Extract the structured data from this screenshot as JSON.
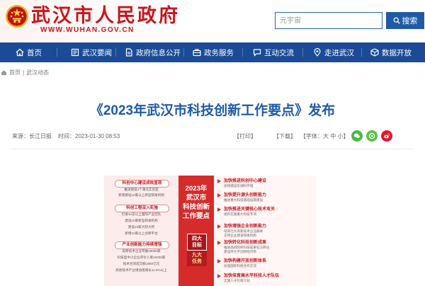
{
  "header": {
    "title": "武汉市人民政府",
    "site_url": "WWW.WUHAN.GOV.CN",
    "search_placeholder": "元宇宙",
    "search_button": "搜索"
  },
  "nav": [
    {
      "label": "首页",
      "icon": "home-icon"
    },
    {
      "label": "武汉要闻",
      "icon": "news-icon"
    },
    {
      "label": "政府信息公开",
      "icon": "document-icon"
    },
    {
      "label": "政务服务",
      "icon": "briefcase-icon"
    },
    {
      "label": "互动交流",
      "icon": "chat-icon"
    },
    {
      "label": "走进武汉",
      "icon": "map-pin-icon"
    },
    {
      "label": "数据开放",
      "icon": "data-icon"
    }
  ],
  "breadcrumb": {
    "home": "首页",
    "separator": "|",
    "current": "武汉动态"
  },
  "article": {
    "title": "《2023年武汉市科技创新工作要点》发布",
    "source": "来源：长江日报",
    "time": "时间：2023-01-30 08:53",
    "print": "【打印】",
    "download": "【下载】",
    "font_prefix": "【字体：",
    "font_large": "大",
    "font_medium": "中",
    "font_small": "小",
    "font_suffix": "】"
  },
  "share": [
    {
      "icon": "wechat-icon",
      "color": "#4cb848"
    },
    {
      "icon": "moments-icon",
      "color": "#5cc24a"
    },
    {
      "icon": "weibo-icon",
      "color": "#e6162d"
    }
  ],
  "infographic": {
    "center_title": [
      "2023年",
      "武汉市",
      "科技创新",
      "工作要点"
    ],
    "goals": [
      "四大",
      "目标"
    ],
    "tasks": [
      "九大",
      "任务"
    ],
    "left": [
      {
        "heading": "科创中心建设成效显现",
        "lines": [
          "推进建设4个湖北实验室",
          "新增建设10家以上新型研发机构"
        ]
      },
      {
        "heading": "科创工程深入实施",
        "lines": [
          "引进10支以上国际产业团队",
          "建设10家新型研发机构",
          "建设10家大院大所",
          "新增10家以上创新平台"
        ]
      },
      {
        "heading": "产业创新能力持续增强",
        "lines": [
          "高新技术企业突破15000家",
          "科技型中小企业评价入库16000家",
          "技术合同成交额1850亿元",
          "高新技术产业增加值增长11.5%以上"
        ]
      }
    ],
    "right": [
      {
        "heading": "加快推进科创中心建设",
        "lines": [
          "加快建设东湖科学城"
        ]
      },
      {
        "heading": "加快提升源头创新能力",
        "lines": [
          "推进重大科技基础设施建设"
        ]
      },
      {
        "heading": "加快推进关键核心技术攻关",
        "lines": [
          "组织实施重大科技专项"
        ]
      },
      {
        "heading": "加快增强企业创新能力",
        "lines": [
          "培育壮大高新技术企业群体",
          "支持企业建设研发机构"
        ]
      },
      {
        "heading": "加快转化科技创新成果",
        "lines": [
          "推进高校院所科技成果在汉转化",
          "建设环大学创新经济带"
        ]
      },
      {
        "heading": "加快构建开放创新体系",
        "lines": [
          "加强国际科技合作交流"
        ]
      },
      {
        "heading": "加快培育高水平科技人才队伍",
        "lines": [
          "实施人才引育计划"
        ]
      }
    ]
  },
  "colors": {
    "brand_red": "#c8161d",
    "nav_blue": "#1b4b96",
    "title_blue": "#1e5aa8",
    "infographic_red": "#d62b2b"
  }
}
